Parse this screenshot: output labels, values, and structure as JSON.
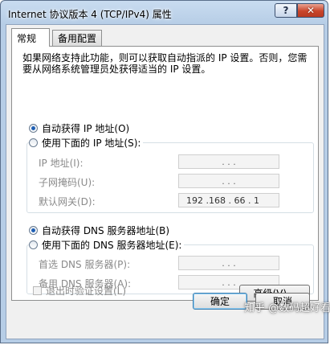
{
  "window": {
    "title": "Internet 协议版本 4 (TCP/IPv4) 属性",
    "help_label": "?",
    "close_label": "✕"
  },
  "tabs": [
    {
      "label": "常规",
      "active": true
    },
    {
      "label": "备用配置",
      "active": false
    }
  ],
  "description": "如果网络支持此功能，则可以获取自动指派的 IP 设置。否则，您需要从网络系统管理员处获得适当的 IP 设置。",
  "ip_section": {
    "auto_label": "自动获得 IP 地址(O)",
    "manual_label": "使用下面的 IP 地址(S):",
    "selected": "auto",
    "fields": [
      {
        "label": "IP 地址(I):",
        "value": ". . ."
      },
      {
        "label": "子网掩码(U):",
        "value": ". . ."
      },
      {
        "label": "默认网关(D):",
        "value": "192 .168 . 66 . 1"
      }
    ]
  },
  "dns_section": {
    "auto_label": "自动获得 DNS 服务器地址(B)",
    "manual_label": "使用下面的 DNS 服务器地址(E):",
    "selected": "auto",
    "fields": [
      {
        "label": "首选 DNS 服务器(P):",
        "value": ". . ."
      },
      {
        "label": "备用 DNS 服务器(A):",
        "value": ". . ."
      }
    ]
  },
  "validate_label": "退出时验证设置(L)",
  "advanced_label": "高级(V)...",
  "ok_label": "确定",
  "cancel_label": "取消",
  "watermark": "知乎 @数码超好看"
}
